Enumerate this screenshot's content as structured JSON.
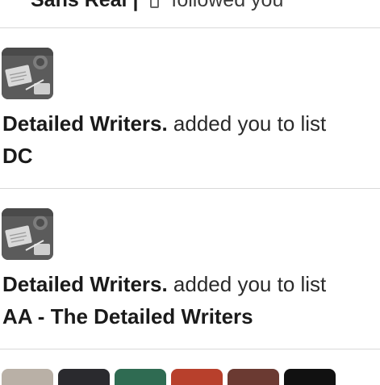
{
  "top_notification": {
    "name": "Sans Real",
    "separator": "|",
    "action": "followed you"
  },
  "notifications": [
    {
      "avatar_icon": "writing-desk-photo-icon",
      "name": "Detailed Writers.",
      "action": " added you to list",
      "list_name": "DC"
    },
    {
      "avatar_icon": "writing-desk-photo-icon",
      "name": "Detailed Writers.",
      "action": " added you to list",
      "list_name": "AA - The Detailed Writers"
    }
  ],
  "bottom_avatars": [
    {
      "icon": "user-avatar-icon",
      "color": "#b9b0a6"
    },
    {
      "icon": "user-avatar-icon",
      "color": "#2a2a2e"
    },
    {
      "icon": "user-avatar-icon",
      "color": "#2f6b52"
    },
    {
      "icon": "user-avatar-icon",
      "color": "#b8402c"
    },
    {
      "icon": "user-avatar-icon",
      "color": "#6b3a32"
    },
    {
      "icon": "user-avatar-icon",
      "color": "#111111"
    }
  ]
}
